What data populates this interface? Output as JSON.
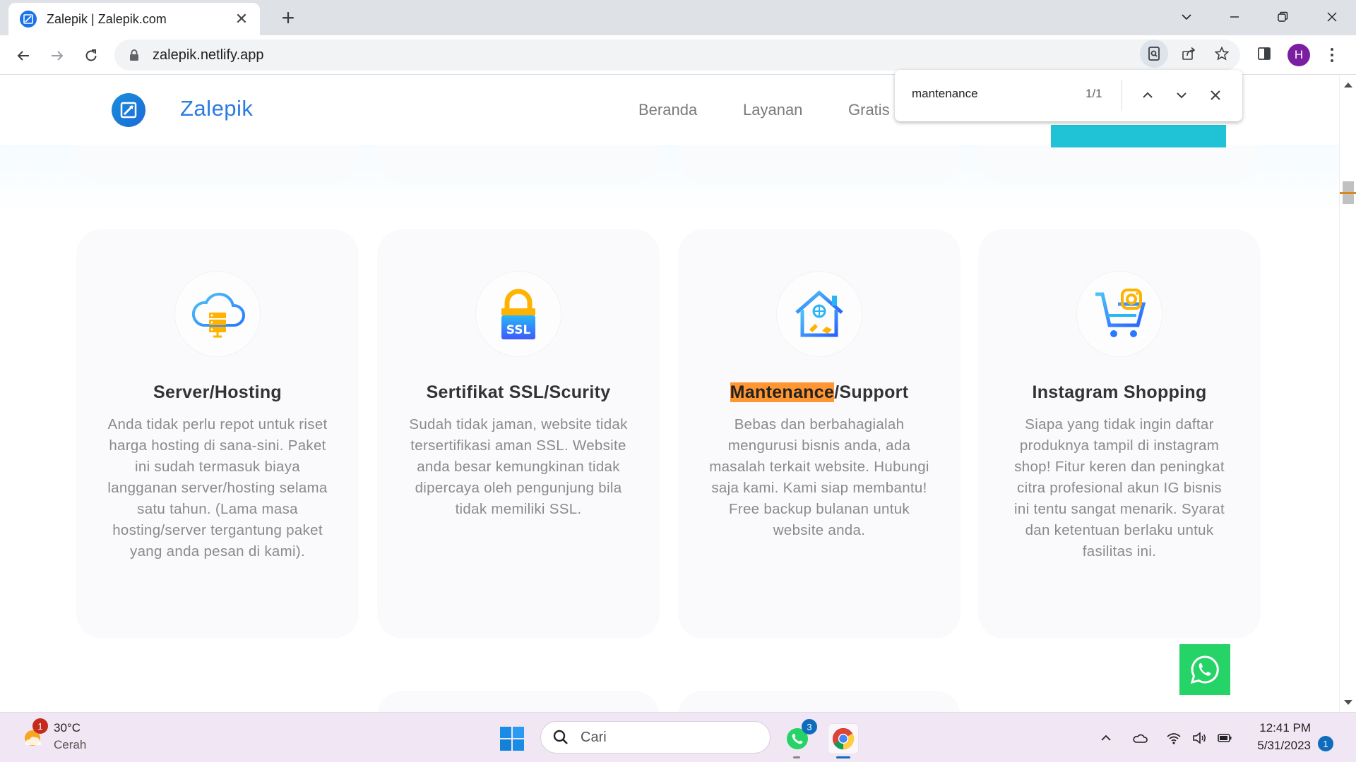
{
  "browser": {
    "tab_title": "Zalepik | Zalepik.com",
    "url": "zalepik.netlify.app",
    "profile_initial": "H"
  },
  "find_bar": {
    "query": "mantenance",
    "count": "1/1"
  },
  "site": {
    "brand": "Zalepik",
    "nav": [
      "Beranda",
      "Layanan",
      "Gratis"
    ]
  },
  "services": [
    {
      "icon": "cloud-server-icon",
      "title": "Server/Hosting",
      "description": "Anda tidak perlu repot untuk riset harga hosting di sana-sini. Paket ini sudah termasuk biaya langganan server/hosting selama satu tahun. (Lama masa hosting/server tergantung paket yang anda pesan di kami)."
    },
    {
      "icon": "ssl-lock-icon",
      "title": "Sertifikat SSL/Scurity",
      "description": "Sudah tidak jaman, website tidak tersertifikasi aman SSL. Website anda besar kemungkinan tidak dipercaya oleh pengunjung bila tidak memiliki SSL."
    },
    {
      "icon": "house-repair-icon",
      "title_highlight": "Mantenance",
      "title_rest": "/Support",
      "description": "Bebas dan berbahagialah mengurusi bisnis anda, ada masalah terkait website. Hubungi saja kami. Kami siap membantu! Free backup bulanan untuk website anda."
    },
    {
      "icon": "instagram-cart-icon",
      "title": "Instagram Shopping",
      "description": "Siapa yang tidak ingin daftar produknya tampil di instagram shop! Fitur keren dan peningkat citra profesional akun IG bisnis ini tentu sangat menarik. Syarat dan ketentuan berlaku untuk fasilitas ini."
    }
  ],
  "taskbar": {
    "weather_temp": "30°C",
    "weather_desc": "Cerah",
    "weather_badge": "1",
    "search_placeholder": "Cari",
    "whatsapp_badge": "3",
    "time": "12:41 PM",
    "date": "5/31/2023",
    "notification_count": "1"
  },
  "colors": {
    "brand_blue": "#2b7be0",
    "highlight_orange": "#ff9632",
    "whatsapp_green": "#25d366",
    "cta_cyan": "#20c3d6"
  }
}
